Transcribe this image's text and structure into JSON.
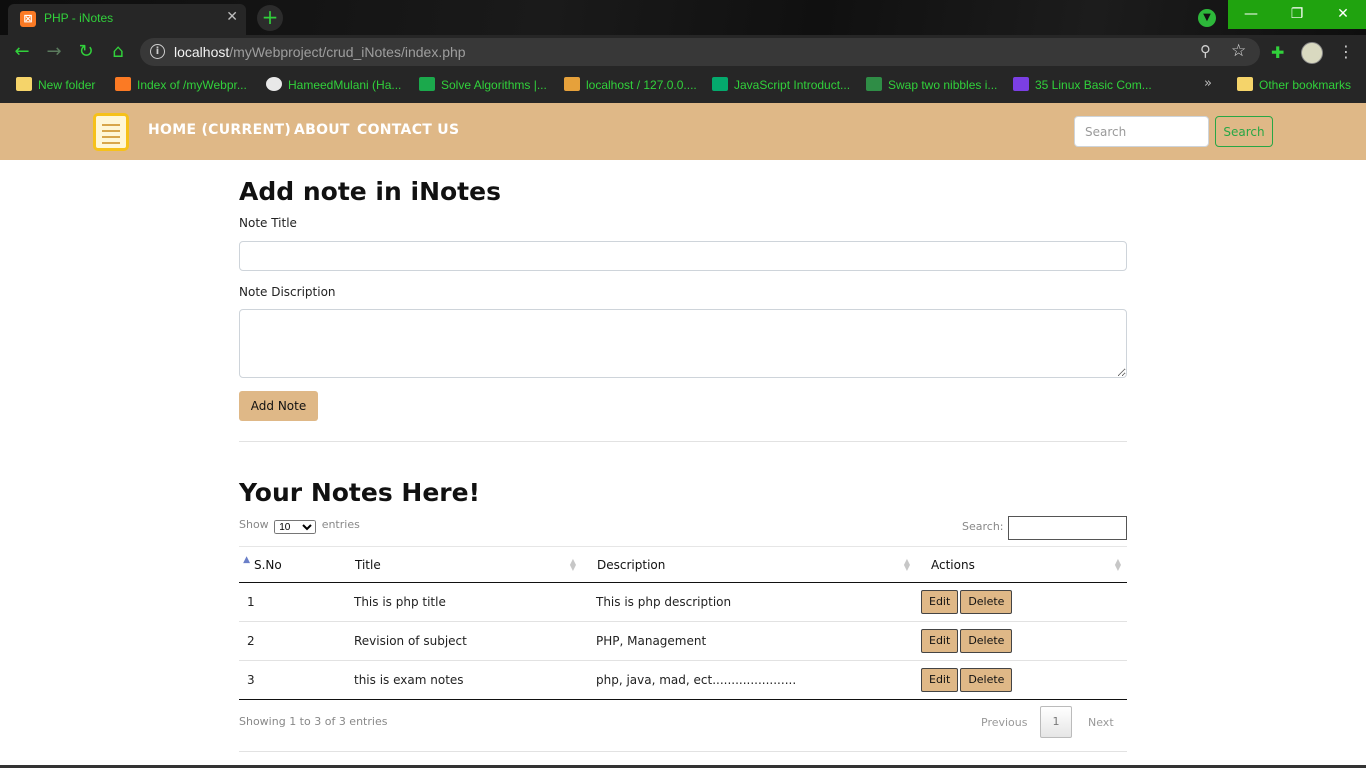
{
  "browser": {
    "tab_title": "PHP - iNotes",
    "tab_favicon": "xampp-icon",
    "tab_close": "✕",
    "new_tab": "+",
    "url_host": "localhost",
    "url_path": "/myWebproject/crud_iNotes/index.php",
    "window_controls": {
      "minimize": "—",
      "maximize": "❐",
      "close": "✕"
    },
    "accent_color": "#31d13b"
  },
  "bookmarks": {
    "items": [
      {
        "label": "New folder",
        "icon": "folder-icon"
      },
      {
        "label": "Index of /myWebpr...",
        "icon": "xampp-icon"
      },
      {
        "label": "HameedMulani (Ha...",
        "icon": "github-icon"
      },
      {
        "label": "Solve Algorithms |...",
        "icon": "hackerrank-icon"
      },
      {
        "label": "localhost / 127.0.0....",
        "icon": "phpmyadmin-icon"
      },
      {
        "label": "JavaScript Introduct...",
        "icon": "w3schools-icon"
      },
      {
        "label": "Swap two nibbles i...",
        "icon": "geeksforgeeks-icon"
      },
      {
        "label": "35 Linux Basic Com...",
        "icon": "linux-icon"
      }
    ],
    "more": "»",
    "other": "Other bookmarks"
  },
  "nav": {
    "brand_color": "#dfb887",
    "home": "HOME (CURRENT)",
    "about": "ABOUT",
    "contact": "CONTACT US",
    "search_placeholder": "Search",
    "search_button": "Search"
  },
  "form": {
    "heading": "Add note in iNotes",
    "title_label": "Note Title",
    "desc_label": "Note Discription",
    "submit": "Add Note"
  },
  "notes": {
    "heading": "Your Notes Here!",
    "show_prefix": "Show",
    "show_value": "10",
    "show_suffix": "entries",
    "search_label": "Search:",
    "columns": [
      "S.No",
      "Title",
      "Description",
      "Actions"
    ],
    "rows": [
      {
        "sno": "1",
        "title": "This is php title",
        "description": "This is php description",
        "edit": "Edit",
        "delete": "Delete"
      },
      {
        "sno": "2",
        "title": "Revision of subject",
        "description": "PHP, Management",
        "edit": "Edit",
        "delete": "Delete"
      },
      {
        "sno": "3",
        "title": "this is exam notes",
        "description": "php, java, mad, ect......................",
        "edit": "Edit",
        "delete": "Delete"
      }
    ],
    "info": "Showing 1 to 3 of 3 entries",
    "previous": "Previous",
    "page": "1",
    "next": "Next"
  }
}
